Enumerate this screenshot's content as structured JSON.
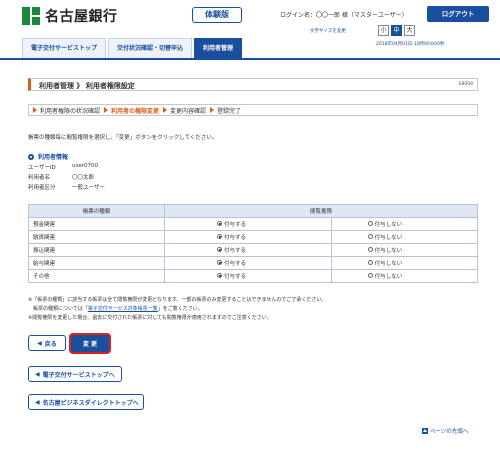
{
  "header": {
    "bank_name": "名古屋銀行",
    "trial_badge": "体験版",
    "login_name": "ログイン名：〇〇一郎 様（マスターユーザー）",
    "logout": "ログアウト",
    "font_size_label": "文字サイズを変更",
    "font_sizes": [
      "小",
      "中",
      "大"
    ],
    "date_line": "2018年04月01日 10時00分00秒"
  },
  "nav": {
    "tabs": [
      "電子交付サービストップ",
      "交付状況確認・切替申込",
      "利用者管理"
    ],
    "active_index": 2
  },
  "page": {
    "title": "利用者管理 》 利用者権限設定",
    "screen_id": "E8008",
    "steps": [
      "利用者権限の状況確認",
      "利用者の権限変更",
      "変更内容確認",
      "登録完了"
    ],
    "active_step": 1,
    "instruction": "帳票の種類毎に閲覧権限を選択し、「変更」ボタンをクリックしてください。"
  },
  "user_info": {
    "heading": "利用者情報",
    "rows": [
      {
        "label": "ユーザーID",
        "value": "user0700"
      },
      {
        "label": "利用者名",
        "value": "〇〇太郎"
      },
      {
        "label": "利用者区分",
        "value": "一般ユーザー"
      }
    ]
  },
  "permission_table": {
    "col_type": "帳票の種類",
    "col_perm": "閲覧権限",
    "grant_label": "付与する",
    "deny_label": "付与しない",
    "rows": [
      {
        "type": "預金関連",
        "granted": true
      },
      {
        "type": "融資関連",
        "granted": true
      },
      {
        "type": "振込関連",
        "granted": true
      },
      {
        "type": "給与関連",
        "granted": true
      },
      {
        "type": "その他",
        "granted": true
      }
    ]
  },
  "notes": {
    "line1": "※「帳票の種類」に該当する帳票は全て閲覧権限が変更となります。一部の帳票のみ変更することはできませんのでご了承ください。",
    "line2_prefix": "　帳票の種類については「",
    "line2_link": "電子交付サービス対象帳票一覧",
    "line2_suffix": "」をご覧ください。",
    "line3": "※閲覧権限を変更した場合、過去に交付された帳票に対しても閲覧権限が適用されますのでご注意ください。"
  },
  "buttons": {
    "back": "戻る",
    "change": "変 更",
    "service_top": "電子交付サービストップへ",
    "direct_top": "名古屋ビジネスダイレクトトップへ",
    "page_top": "ページの先頭へ"
  }
}
